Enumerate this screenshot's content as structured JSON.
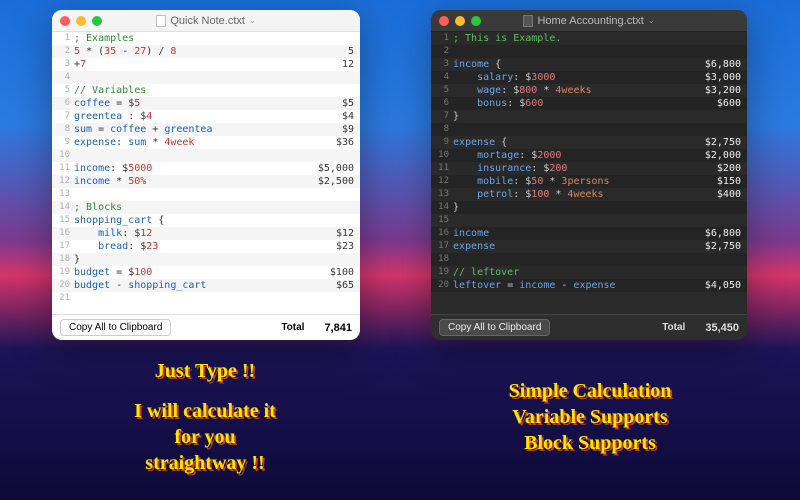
{
  "windows": [
    {
      "id": "light",
      "title": "Quick Note.ctxt",
      "copy_label": "Copy All to Clipboard",
      "total_label": "Total",
      "total_value": "7,841",
      "lines": [
        {
          "n": 1,
          "tokens": [
            [
              "c-com",
              "; Examples"
            ]
          ],
          "result": ""
        },
        {
          "n": 2,
          "tokens": [
            [
              "c-num",
              "5"
            ],
            [
              "c-op",
              " * ("
            ],
            [
              "c-num",
              "35"
            ],
            [
              "c-op",
              " - "
            ],
            [
              "c-num",
              "27"
            ],
            [
              "c-op",
              ") / "
            ],
            [
              "c-num",
              "8"
            ]
          ],
          "result": "5"
        },
        {
          "n": 3,
          "tokens": [
            [
              "c-op",
              "+"
            ],
            [
              "c-num",
              "7"
            ]
          ],
          "result": "12"
        },
        {
          "n": 4,
          "tokens": [],
          "result": ""
        },
        {
          "n": 5,
          "tokens": [
            [
              "c-com",
              "// Variables"
            ]
          ],
          "result": ""
        },
        {
          "n": 6,
          "tokens": [
            [
              "c-var",
              "coffee"
            ],
            [
              "c-op",
              " = "
            ],
            [
              "c-str",
              "$"
            ],
            [
              "c-num",
              "5"
            ]
          ],
          "result": "$5"
        },
        {
          "n": 7,
          "tokens": [
            [
              "c-var",
              "greentea"
            ],
            [
              "c-op",
              " : "
            ],
            [
              "c-str",
              "$"
            ],
            [
              "c-num",
              "4"
            ]
          ],
          "result": "$4"
        },
        {
          "n": 8,
          "tokens": [
            [
              "c-var",
              "sum"
            ],
            [
              "c-op",
              " = "
            ],
            [
              "c-var",
              "coffee"
            ],
            [
              "c-op",
              " + "
            ],
            [
              "c-var",
              "greentea"
            ]
          ],
          "result": "$9"
        },
        {
          "n": 9,
          "tokens": [
            [
              "c-var",
              "expense"
            ],
            [
              "c-op",
              ": "
            ],
            [
              "c-var",
              "sum"
            ],
            [
              "c-op",
              " * "
            ],
            [
              "c-num",
              "4"
            ],
            [
              "c-id",
              "week"
            ]
          ],
          "result": "$36"
        },
        {
          "n": 10,
          "tokens": [],
          "result": ""
        },
        {
          "n": 11,
          "tokens": [
            [
              "c-var",
              "income"
            ],
            [
              "c-op",
              ": "
            ],
            [
              "c-str",
              "$"
            ],
            [
              "c-num",
              "5000"
            ]
          ],
          "result": "$5,000"
        },
        {
          "n": 12,
          "tokens": [
            [
              "c-var",
              "income"
            ],
            [
              "c-op",
              " * "
            ],
            [
              "c-num",
              "50"
            ],
            [
              "c-id",
              "%"
            ]
          ],
          "result": "$2,500"
        },
        {
          "n": 13,
          "tokens": [],
          "result": ""
        },
        {
          "n": 14,
          "tokens": [
            [
              "c-com",
              "; Blocks"
            ]
          ],
          "result": ""
        },
        {
          "n": 15,
          "tokens": [
            [
              "c-var",
              "shopping_cart"
            ],
            [
              "c-op",
              " {"
            ]
          ],
          "result": ""
        },
        {
          "n": 16,
          "tokens": [
            [
              "c-op",
              "    "
            ],
            [
              "c-var",
              "milk"
            ],
            [
              "c-op",
              ": "
            ],
            [
              "c-str",
              "$"
            ],
            [
              "c-num",
              "12"
            ]
          ],
          "result": "$12"
        },
        {
          "n": 17,
          "tokens": [
            [
              "c-op",
              "    "
            ],
            [
              "c-var",
              "bread"
            ],
            [
              "c-op",
              ": "
            ],
            [
              "c-str",
              "$"
            ],
            [
              "c-num",
              "23"
            ]
          ],
          "result": "$23"
        },
        {
          "n": 18,
          "tokens": [
            [
              "c-op",
              "}"
            ]
          ],
          "result": ""
        },
        {
          "n": 19,
          "tokens": [
            [
              "c-var",
              "budget"
            ],
            [
              "c-op",
              " = "
            ],
            [
              "c-str",
              "$"
            ],
            [
              "c-num",
              "100"
            ]
          ],
          "result": "$100"
        },
        {
          "n": 20,
          "tokens": [
            [
              "c-var",
              "budget"
            ],
            [
              "c-op",
              " - "
            ],
            [
              "c-var",
              "shopping_cart"
            ]
          ],
          "result": "$65"
        },
        {
          "n": 21,
          "tokens": [],
          "result": ""
        }
      ]
    },
    {
      "id": "dark",
      "title": "Home Accounting.ctxt",
      "copy_label": "Copy All to Clipboard",
      "total_label": "Total",
      "total_value": "35,450",
      "lines": [
        {
          "n": 1,
          "tokens": [
            [
              "c-com",
              "; This is Example."
            ]
          ],
          "result": ""
        },
        {
          "n": 2,
          "tokens": [],
          "result": ""
        },
        {
          "n": 3,
          "tokens": [
            [
              "c-var",
              "income"
            ],
            [
              "c-op",
              " {"
            ]
          ],
          "result": "$6,800"
        },
        {
          "n": 4,
          "tokens": [
            [
              "c-op",
              "    "
            ],
            [
              "c-var",
              "salary"
            ],
            [
              "c-op",
              ": "
            ],
            [
              "c-str",
              "$"
            ],
            [
              "c-num",
              "3000"
            ]
          ],
          "result": "$3,000"
        },
        {
          "n": 5,
          "tokens": [
            [
              "c-op",
              "    "
            ],
            [
              "c-var",
              "wage"
            ],
            [
              "c-op",
              ": "
            ],
            [
              "c-str",
              "$"
            ],
            [
              "c-num",
              "800"
            ],
            [
              "c-op",
              " * "
            ],
            [
              "c-num",
              "4"
            ],
            [
              "c-id",
              "weeks"
            ]
          ],
          "result": "$3,200"
        },
        {
          "n": 6,
          "tokens": [
            [
              "c-op",
              "    "
            ],
            [
              "c-var",
              "bonus"
            ],
            [
              "c-op",
              ": "
            ],
            [
              "c-str",
              "$"
            ],
            [
              "c-num",
              "600"
            ]
          ],
          "result": "$600"
        },
        {
          "n": 7,
          "tokens": [
            [
              "c-op",
              "}"
            ]
          ],
          "result": ""
        },
        {
          "n": 8,
          "tokens": [],
          "result": ""
        },
        {
          "n": 9,
          "tokens": [
            [
              "c-var",
              "expense"
            ],
            [
              "c-op",
              " {"
            ]
          ],
          "result": "$2,750"
        },
        {
          "n": 10,
          "tokens": [
            [
              "c-op",
              "    "
            ],
            [
              "c-var",
              "mortage"
            ],
            [
              "c-op",
              ": "
            ],
            [
              "c-str",
              "$"
            ],
            [
              "c-num",
              "2000"
            ]
          ],
          "result": "$2,000"
        },
        {
          "n": 11,
          "tokens": [
            [
              "c-op",
              "    "
            ],
            [
              "c-var",
              "insurance"
            ],
            [
              "c-op",
              ": "
            ],
            [
              "c-str",
              "$"
            ],
            [
              "c-num",
              "200"
            ]
          ],
          "result": "$200"
        },
        {
          "n": 12,
          "tokens": [
            [
              "c-op",
              "    "
            ],
            [
              "c-var",
              "mobile"
            ],
            [
              "c-op",
              ": "
            ],
            [
              "c-str",
              "$"
            ],
            [
              "c-num",
              "50"
            ],
            [
              "c-op",
              " * "
            ],
            [
              "c-num",
              "3"
            ],
            [
              "c-id",
              "persons"
            ]
          ],
          "result": "$150"
        },
        {
          "n": 13,
          "tokens": [
            [
              "c-op",
              "    "
            ],
            [
              "c-var",
              "petrol"
            ],
            [
              "c-op",
              ": "
            ],
            [
              "c-str",
              "$"
            ],
            [
              "c-num",
              "100"
            ],
            [
              "c-op",
              " * "
            ],
            [
              "c-num",
              "4"
            ],
            [
              "c-id",
              "weeks"
            ]
          ],
          "result": "$400"
        },
        {
          "n": 14,
          "tokens": [
            [
              "c-op",
              "}"
            ]
          ],
          "result": ""
        },
        {
          "n": 15,
          "tokens": [],
          "result": ""
        },
        {
          "n": 16,
          "tokens": [
            [
              "c-var",
              "income"
            ]
          ],
          "result": "$6,800"
        },
        {
          "n": 17,
          "tokens": [
            [
              "c-var",
              "expense"
            ]
          ],
          "result": "$2,750"
        },
        {
          "n": 18,
          "tokens": [],
          "result": ""
        },
        {
          "n": 19,
          "tokens": [
            [
              "c-com",
              "// leftover"
            ]
          ],
          "result": ""
        },
        {
          "n": 20,
          "tokens": [
            [
              "c-var",
              "leftover"
            ],
            [
              "c-op",
              " = "
            ],
            [
              "c-var",
              "income"
            ],
            [
              "c-op",
              " - "
            ],
            [
              "c-var",
              "expense"
            ]
          ],
          "result": "$4,050"
        }
      ]
    }
  ],
  "captions": {
    "left_line1": "Just Type !!",
    "left_line2": "I will calculate it",
    "left_line3": "for you",
    "left_line4": "straightway !!",
    "right_line1": "Simple Calculation",
    "right_line2": "Variable Supports",
    "right_line3": "Block Supports"
  }
}
